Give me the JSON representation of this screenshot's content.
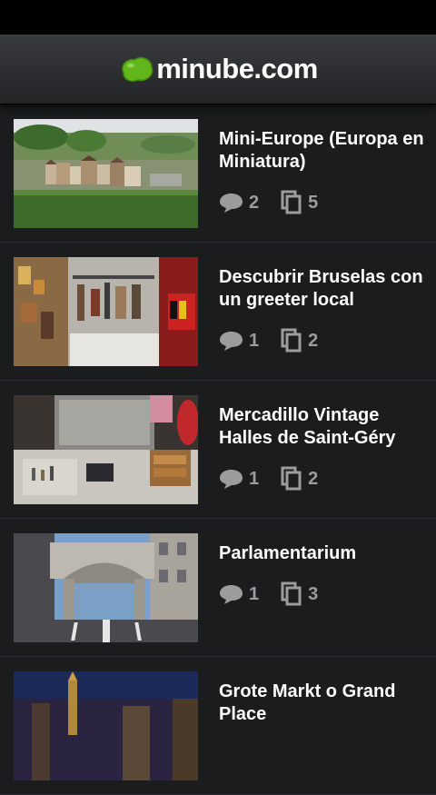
{
  "header": {
    "brand": "minube.com"
  },
  "items": [
    {
      "title": "Mini-Europe (Europa en Miniatura)",
      "comments": "2",
      "photos": "5",
      "theme": "miniature"
    },
    {
      "title": "Descubrir Bruselas con un greeter local",
      "comments": "1",
      "photos": "2",
      "theme": "shop"
    },
    {
      "title": "Mercadillo Vintage Halles de Saint-Géry",
      "comments": "1",
      "photos": "2",
      "theme": "market"
    },
    {
      "title": "Parlamentarium",
      "comments": "1",
      "photos": "3",
      "theme": "street"
    },
    {
      "title": "Grote Markt o Grand Place",
      "comments": "",
      "photos": "",
      "theme": "night"
    }
  ],
  "colors": {
    "brand_green": "#62b51b",
    "meta_gray": "#9b9c9e",
    "background": "#1b1c1e"
  },
  "icons": {
    "comment": "speech-bubble-icon",
    "photos": "photo-stack-icon"
  }
}
